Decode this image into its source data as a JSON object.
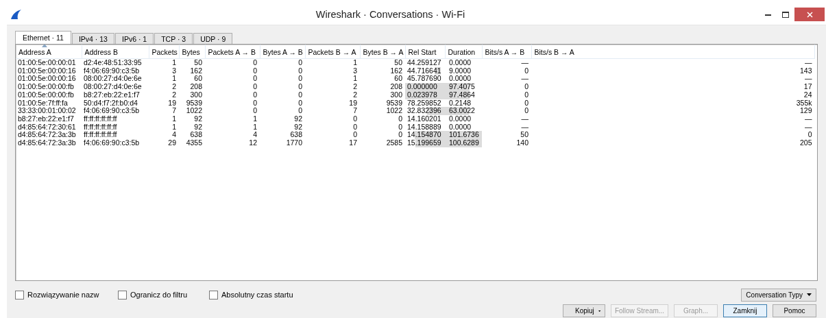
{
  "window": {
    "title": "Wireshark · Conversations · Wi-Fi"
  },
  "tabs": [
    {
      "label": "Ethernet · 11",
      "selected": true
    },
    {
      "label": "IPv4 · 13",
      "selected": false
    },
    {
      "label": "IPv6 · 1",
      "selected": false
    },
    {
      "label": "TCP · 3",
      "selected": false
    },
    {
      "label": "UDP · 9",
      "selected": false
    }
  ],
  "table": {
    "columns": [
      {
        "label": "Address A",
        "sorted": true
      },
      {
        "label": "Address B",
        "sorted": false
      },
      {
        "label": "Packets",
        "sorted": false
      },
      {
        "label": "Bytes",
        "sorted": false
      },
      {
        "label": "Packets A → B",
        "sorted": false
      },
      {
        "label": "Bytes A → B",
        "sorted": false
      },
      {
        "label": "Packets B → A",
        "sorted": false
      },
      {
        "label": "Bytes B → A",
        "sorted": false
      },
      {
        "label": "Rel Start",
        "sorted": false
      },
      {
        "label": "Duration",
        "sorted": false
      },
      {
        "label": "Bits/s A → B",
        "sorted": false
      },
      {
        "label": "Bits/s B → A",
        "sorted": false
      }
    ],
    "rows": [
      [
        "01:00:5e:00:00:01",
        "d2:4e:48:51:33:95",
        "1",
        "50",
        "0",
        "0",
        "1",
        "50",
        "44.259127",
        "0.0000",
        "—",
        "—"
      ],
      [
        "01:00:5e:00:00:16",
        "f4:06:69:90:c3:5b",
        "3",
        "162",
        "0",
        "0",
        "3",
        "162",
        "44.716641",
        "9.0000",
        "0",
        "143"
      ],
      [
        "01:00:5e:00:00:16",
        "08:00:27:d4:0e:6e",
        "1",
        "60",
        "0",
        "0",
        "1",
        "60",
        "45.787690",
        "0.0000",
        "—",
        "—"
      ],
      [
        "01:00:5e:00:00:fb",
        "08:00:27:d4:0e:6e",
        "2",
        "208",
        "0",
        "0",
        "2",
        "208",
        "0.000000",
        "97.4075",
        "0",
        "17"
      ],
      [
        "01:00:5e:00:00:fb",
        "b8:27:eb:22:e1:f7",
        "2",
        "300",
        "0",
        "0",
        "2",
        "300",
        "0.023978",
        "97.4864",
        "0",
        "24"
      ],
      [
        "01:00:5e:7f:ff:fa",
        "50:d4:f7:2f:b0:d4",
        "19",
        "9539",
        "0",
        "0",
        "19",
        "9539",
        "78.259852",
        "0.2148",
        "0",
        "355k"
      ],
      [
        "33:33:00:01:00:02",
        "f4:06:69:90:c3:5b",
        "7",
        "1022",
        "0",
        "0",
        "7",
        "1022",
        "32.832396",
        "63.0022",
        "0",
        "129"
      ],
      [
        "b8:27:eb:22:e1:f7",
        "ff:ff:ff:ff:ff:ff",
        "1",
        "92",
        "1",
        "92",
        "0",
        "0",
        "14.160201",
        "0.0000",
        "—",
        "—"
      ],
      [
        "d4:85:64:72:30:61",
        "ff:ff:ff:ff:ff:ff",
        "1",
        "92",
        "1",
        "92",
        "0",
        "0",
        "14.158889",
        "0.0000",
        "—",
        "—"
      ],
      [
        "d4:85:64:72:3a:3b",
        "ff:ff:ff:ff:ff:ff",
        "4",
        "638",
        "4",
        "638",
        "0",
        "0",
        "14.154870",
        "101.6736",
        "50",
        "0"
      ],
      [
        "d4:85:64:72:3a:3b",
        "f4:06:69:90:c3:5b",
        "29",
        "4355",
        "12",
        "1770",
        "17",
        "2585",
        "15.199659",
        "100.6289",
        "140",
        "205"
      ]
    ]
  },
  "options": [
    {
      "label": "Rozwiązywanie nazw",
      "checked": false
    },
    {
      "label": "Ogranicz do filtru",
      "checked": false
    },
    {
      "label": "Absolutny czas startu",
      "checked": false
    }
  ],
  "type_menu": {
    "label": "Conversation Typy"
  },
  "buttons": [
    {
      "label": "Kopiuj",
      "kind": "split",
      "disabled": false,
      "default": false
    },
    {
      "label": "Follow Stream...",
      "kind": "plain",
      "disabled": true,
      "default": false
    },
    {
      "label": "Graph...",
      "kind": "plain",
      "disabled": true,
      "default": false
    },
    {
      "label": "Zamknij",
      "kind": "plain",
      "disabled": false,
      "default": true
    },
    {
      "label": "Pomoc",
      "kind": "plain",
      "disabled": false,
      "default": false
    }
  ]
}
